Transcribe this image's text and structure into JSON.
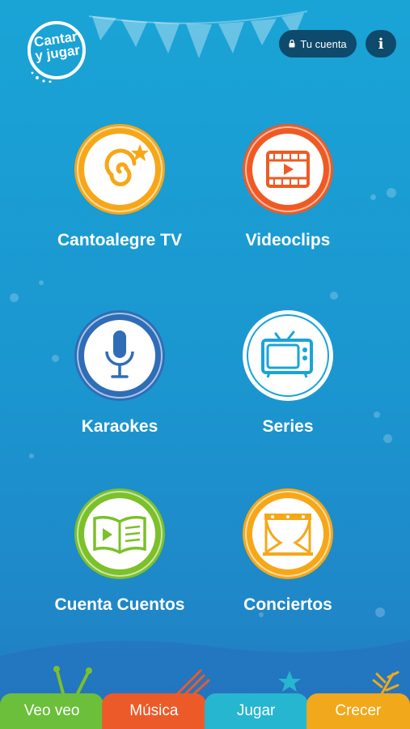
{
  "header": {
    "logo_line1": "Cantar",
    "logo_line2": "y jugar",
    "account_label": "Tu cuenta",
    "info_label": "i"
  },
  "menu": {
    "items": [
      {
        "label": "Cantoalegre TV",
        "icon": "swirl-star-icon",
        "color": "#f6a718"
      },
      {
        "label": "Videoclips",
        "icon": "film-play-icon",
        "color": "#ef5a24"
      },
      {
        "label": "Karaokes",
        "icon": "microphone-icon",
        "color": "#2f6db7"
      },
      {
        "label": "Series",
        "icon": "television-icon",
        "color": "#1aa4d6"
      },
      {
        "label": "Cuenta Cuentos",
        "icon": "book-play-icon",
        "color": "#7cc02a"
      },
      {
        "label": "Conciertos",
        "icon": "stage-curtain-icon",
        "color": "#f6a718"
      }
    ]
  },
  "tabs": [
    {
      "label": "Veo veo",
      "color": "#6bbf3a"
    },
    {
      "label": "Música",
      "color": "#ec5a2a"
    },
    {
      "label": "Jugar",
      "color": "#27b6cf"
    },
    {
      "label": "Crecer",
      "color": "#f1a81a"
    }
  ]
}
